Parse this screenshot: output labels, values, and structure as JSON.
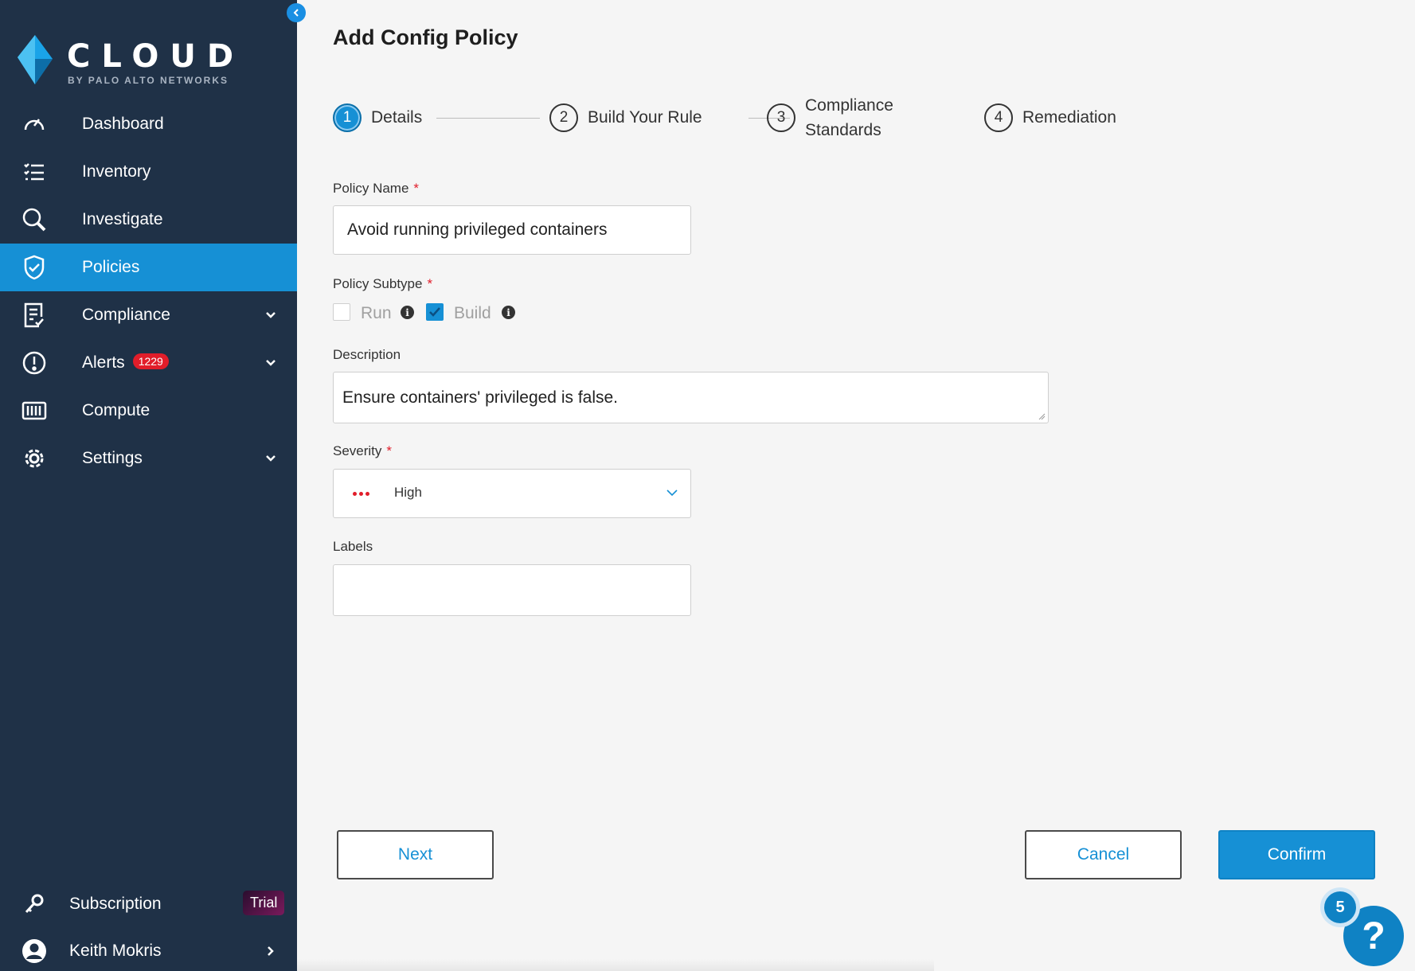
{
  "brand": {
    "logo_word": "CLOUD",
    "logo_sub": "BY PALO ALTO NETWORKS",
    "logo_color": "#3fa9e0"
  },
  "sidebar": {
    "items": [
      {
        "label": "Dashboard",
        "icon": "gauge-icon"
      },
      {
        "label": "Inventory",
        "icon": "checklist-icon"
      },
      {
        "label": "Investigate",
        "icon": "search-icon"
      },
      {
        "label": "Policies",
        "icon": "shield-check-icon",
        "active": true
      },
      {
        "label": "Compliance",
        "icon": "document-check-icon",
        "expandable": true
      },
      {
        "label": "Alerts",
        "icon": "alert-circle-icon",
        "badge": "1229",
        "expandable": true
      },
      {
        "label": "Compute",
        "icon": "container-icon"
      },
      {
        "label": "Settings",
        "icon": "gear-icon",
        "expandable": true
      }
    ],
    "subscription": {
      "label": "Subscription",
      "badge": "Trial",
      "icon": "key-icon"
    },
    "user": {
      "label": "Keith Mokris",
      "icon": "user-icon"
    },
    "collapse_icon": "chevron-left-icon"
  },
  "page": {
    "title": "Add Config Policy"
  },
  "steps": [
    {
      "number": "1",
      "label": "Details",
      "active": true
    },
    {
      "number": "2",
      "label": "Build Your Rule"
    },
    {
      "number": "3",
      "label_line1": "Compliance",
      "label_line2": "Standards"
    },
    {
      "number": "4",
      "label": "Remediation"
    }
  ],
  "form": {
    "policy_name": {
      "label": "Policy Name",
      "required": "*",
      "value": "Avoid running privileged containers"
    },
    "policy_subtype": {
      "label": "Policy Subtype",
      "required": "*",
      "options": [
        {
          "label": "Run",
          "checked": false
        },
        {
          "label": "Build",
          "checked": true
        }
      ],
      "info_glyph": "i"
    },
    "description": {
      "label": "Description",
      "value": "Ensure containers' privileged is false."
    },
    "severity": {
      "label": "Severity",
      "required": "*",
      "value": "High",
      "color": "#e11d2a"
    },
    "labels": {
      "label": "Labels",
      "value": ""
    }
  },
  "actions": {
    "next": "Next",
    "cancel": "Cancel",
    "confirm": "Confirm"
  },
  "help": {
    "glyph": "?",
    "count": "5"
  },
  "colors": {
    "sidebar_bg": "#1f3147",
    "accent": "#1690d5",
    "required": "#e11d2a"
  }
}
